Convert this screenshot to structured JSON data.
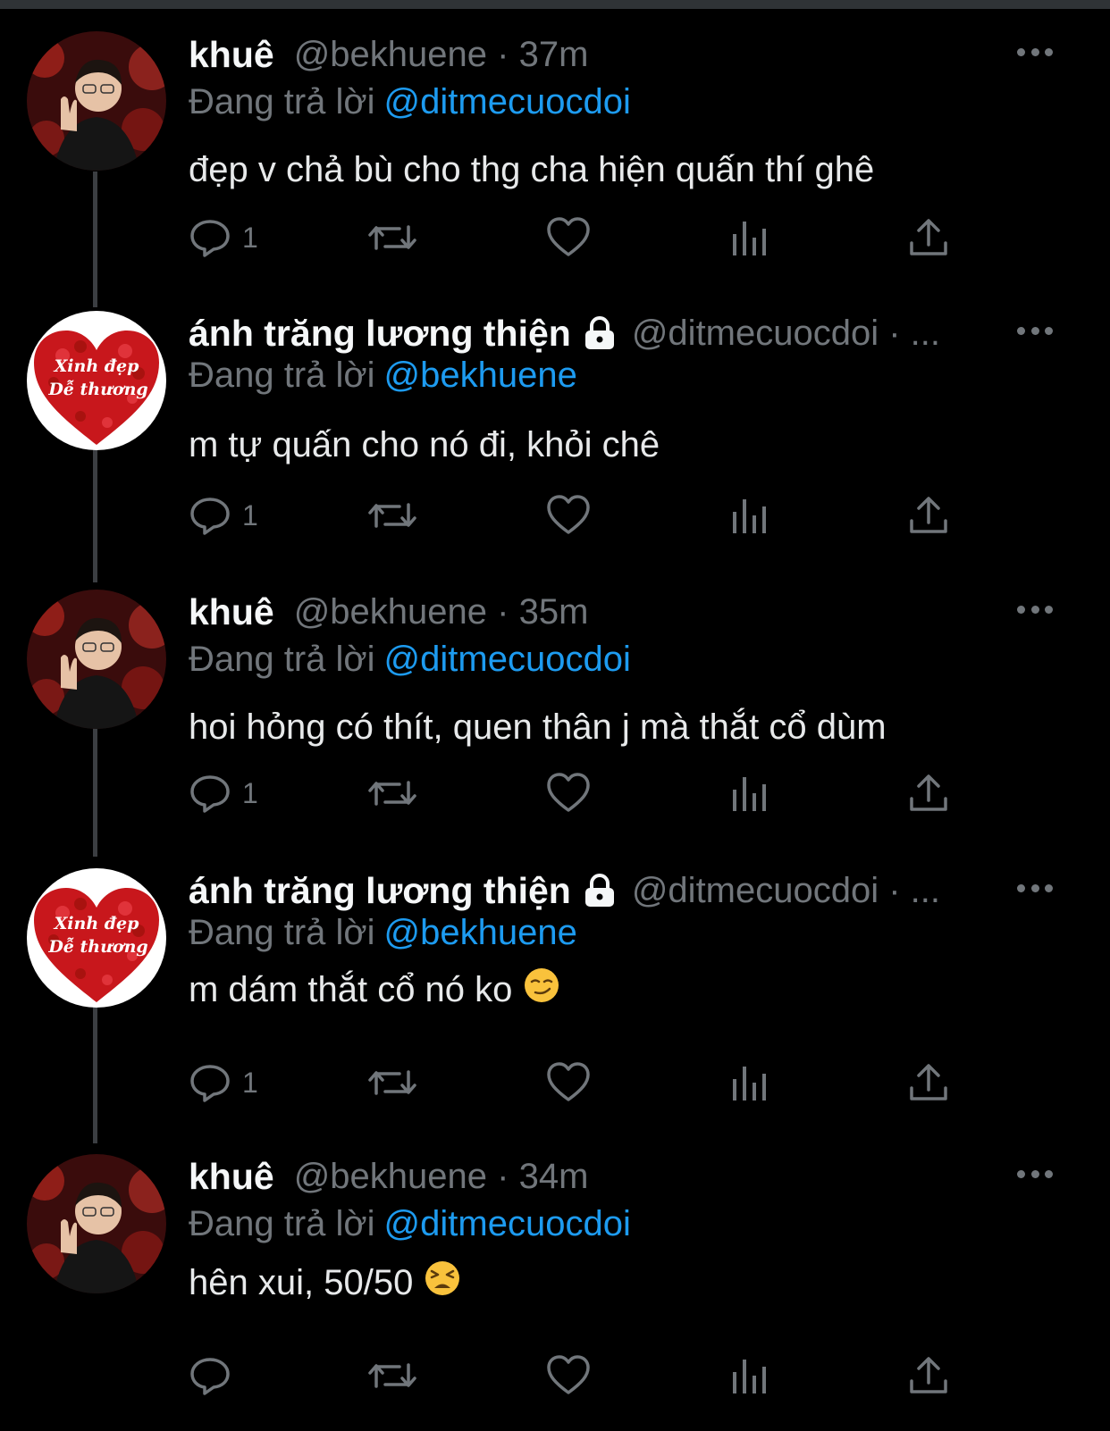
{
  "colors": {
    "background": "#000000",
    "accent": "#1d9bf0",
    "muted": "#71767b",
    "text": "#e7e9ea"
  },
  "tweets": [
    {
      "name": "khuê",
      "handle_time": "@bekhuene · 37m",
      "locked": false,
      "reply_prefix": "Đang trả lời",
      "reply_to": "@ditmecuocdoi",
      "text": "đẹp v chả bù cho thg cha hiện quấn thí ghê",
      "emoji": "",
      "reply_count": "1",
      "avatar": "avatar-khue-photo"
    },
    {
      "name": "ánh trăng lương thiện",
      "handle_time": "@ditmecuocdoi · ...",
      "locked": true,
      "reply_prefix": "Đang trả lời",
      "reply_to": "@bekhuene",
      "text": "m tự quấn cho nó đi, khỏi chê",
      "emoji": "",
      "reply_count": "1",
      "avatar": "avatar-heart",
      "avatar_text_1": "Xinh đẹp",
      "avatar_text_2": "Dễ thương"
    },
    {
      "name": "khuê",
      "handle_time": "@bekhuene · 35m",
      "locked": false,
      "reply_prefix": "Đang trả lời",
      "reply_to": "@ditmecuocdoi",
      "text": "hoi hỏng có thít, quen thân j mà thắt cổ dùm",
      "emoji": "",
      "reply_count": "1",
      "avatar": "avatar-khue-photo"
    },
    {
      "name": "ánh trăng lương thiện",
      "handle_time": "@ditmecuocdoi · ...",
      "locked": true,
      "reply_prefix": "Đang trả lời",
      "reply_to": "@bekhuene",
      "text": "m dám thắt cổ nó ko",
      "emoji": "smirking-face",
      "reply_count": "1",
      "avatar": "avatar-heart",
      "avatar_text_1": "Xinh đẹp",
      "avatar_text_2": "Dễ thương"
    },
    {
      "name": "khuê",
      "handle_time": "@bekhuene · 34m",
      "locked": false,
      "reply_prefix": "Đang trả lời",
      "reply_to": "@ditmecuocdoi",
      "text": "hên xui, 50/50",
      "emoji": "tired-face",
      "reply_count": "",
      "avatar": "avatar-khue-photo"
    }
  ]
}
